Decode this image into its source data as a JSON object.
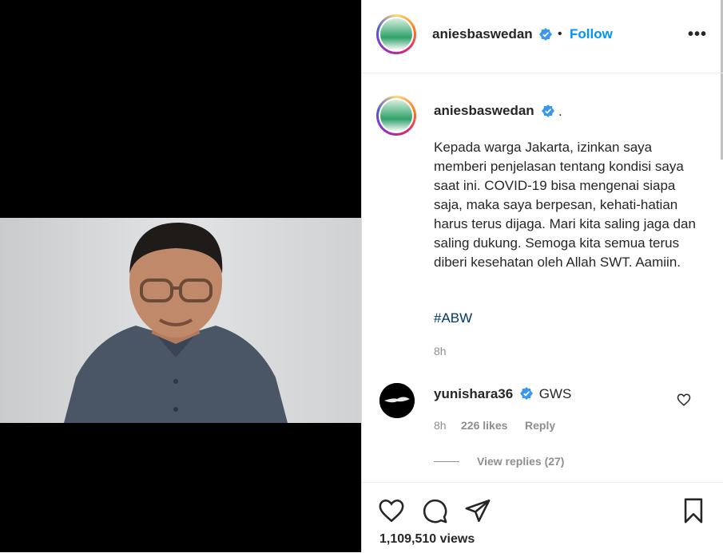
{
  "post": {
    "username": "aniesbaswedan",
    "follow_label": "Follow",
    "separator": "•",
    "more_label": "•••"
  },
  "caption": {
    "username": "aniesbaswedan",
    "trailing": ".",
    "text": "Kepada warga Jakarta, izinkan saya memberi penjelasan tentang kondisi saya saat ini. COVID-19 bisa mengenai siapa saja, maka saya berpesan, kehati-hatian harus terus dijaga. Mari kita saling jaga dan saling dukung. Semoga kita semua terus diberi kesehatan oleh Allah SWT. Aamiin.",
    "hashtag": "#ABW",
    "time": "8h"
  },
  "comment": {
    "username": "yunishara36",
    "text": "GWS",
    "time": "8h",
    "likes": "226 likes",
    "reply_label": "Reply",
    "view_replies": "View replies (27)"
  },
  "footer": {
    "views": "1,109,510 views"
  },
  "colors": {
    "accent": "#0095f6",
    "verified": "#3897f0",
    "hashtag": "#00376b",
    "muted": "#8e8e8e"
  }
}
